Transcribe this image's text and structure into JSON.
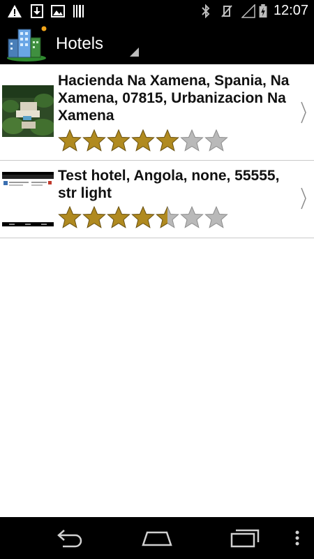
{
  "status_bar": {
    "time": "12:07",
    "left_icons": [
      "warning-icon",
      "download-icon",
      "image-icon",
      "barcode-icon"
    ],
    "right_icons": [
      "bluetooth-icon",
      "vibrate-muted-icon",
      "signal-icon",
      "battery-charging-icon"
    ]
  },
  "action_bar": {
    "title": "Hotels",
    "logo_icon": "hotel-buildings-icon"
  },
  "hotels": [
    {
      "name": "Hacienda Na Xamena, Spania, Na Xamena, 07815, Urbanizacion Na Xamena",
      "rating": 5,
      "max_rating": 7,
      "thumbnail": "hotel-photo-thumbnail"
    },
    {
      "name": "Test hotel, Angola, none, 55555, str light",
      "rating": 4.5,
      "max_rating": 7,
      "thumbnail": "screenshot-thumbnail"
    }
  ],
  "colors": {
    "star_filled": "#b08a20",
    "star_empty": "#b9b9b9",
    "bar_bg": "#000000",
    "divider": "#c9c9c9"
  },
  "nav_bar": {
    "buttons": [
      "back-icon",
      "home-icon",
      "recent-apps-icon",
      "overflow-menu-icon"
    ]
  }
}
